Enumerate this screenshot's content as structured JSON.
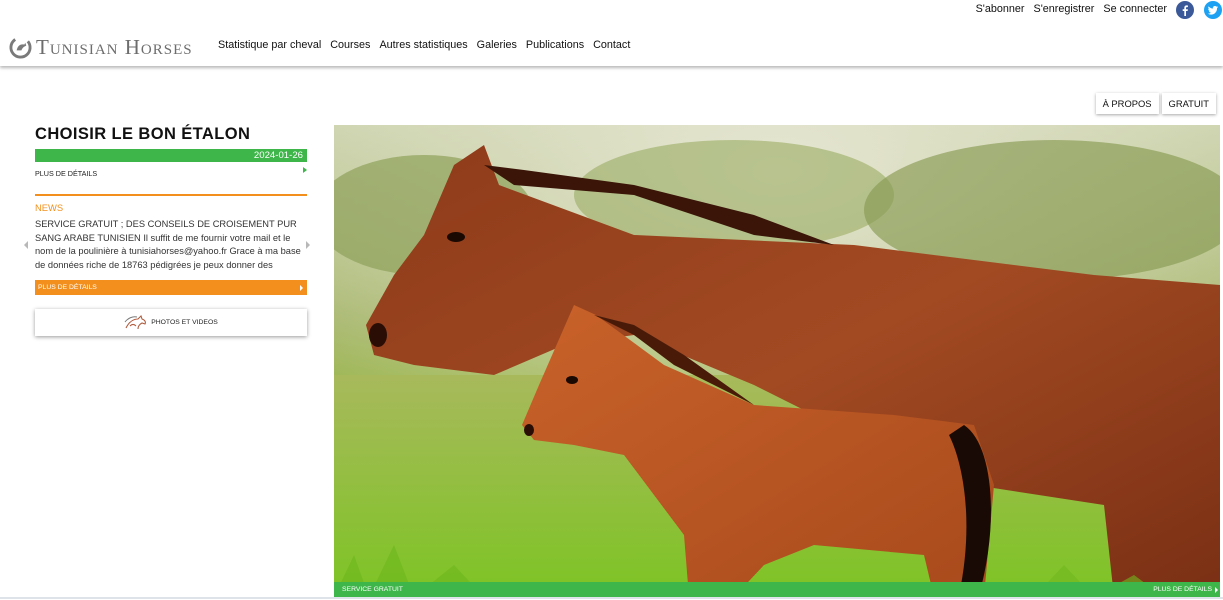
{
  "header": {
    "logo_text": "Tunisian Horses",
    "nav": [
      "Statistique par cheval",
      "Courses",
      "Autres statistiques",
      "Galeries",
      "Publications",
      "Contact"
    ],
    "top_links": [
      "S'abonner",
      "S'enregistrer",
      "Se connecter"
    ],
    "social_icons": [
      "facebook-icon",
      "twitter-icon"
    ],
    "colors": {
      "facebook": "#3b5998",
      "twitter": "#1da1f2"
    }
  },
  "side_tabs": [
    "À PROPOS",
    "GRATUIT"
  ],
  "article": {
    "title": "CHOISIR LE BON ÉTALON",
    "date": "2024-01-26",
    "details_label": "PLUS DE DÉTAILS"
  },
  "news": {
    "label": "NEWS",
    "body": "SERVICE GRATUIT ; DES CONSEILS DE CROISEMENT PUR SANG ARABE TUNISIEN Il suffit de me fournir votre mail et le nom de la poulinière à tunisiahorses@yahoo.fr Grace à ma base de données riche de 18763 pédigrées je peux donner des conseils de croiseme…",
    "details_label": "PLUS DE DÉTAILS"
  },
  "photos_card": {
    "label": "PHOTOS ET VIDEOS",
    "icon": "horse-logo-icon"
  },
  "hero": {
    "footer_left": "SERVICE GRATUIT",
    "footer_right": "PLUS DE DÉTAILS"
  },
  "colors": {
    "accent_green": "#3eb64a",
    "accent_orange": "#f3901d"
  }
}
